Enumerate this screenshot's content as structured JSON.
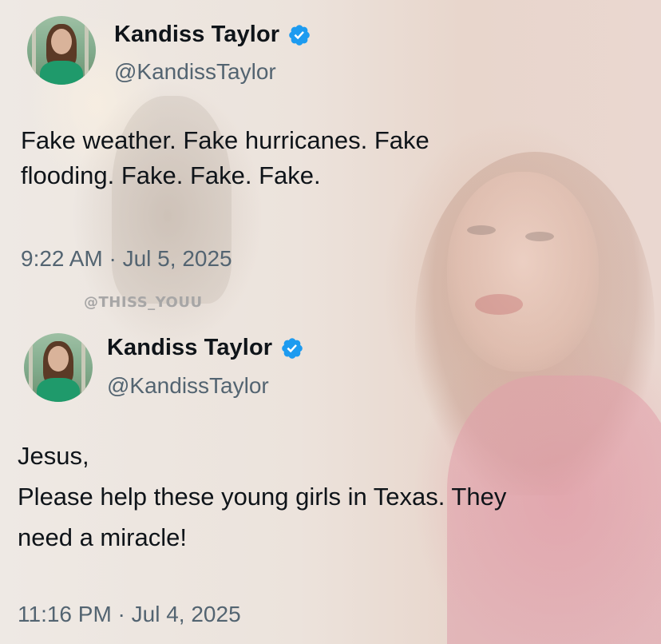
{
  "tweets": [
    {
      "display_name": "Kandiss Taylor",
      "handle": "@KandissTaylor",
      "verified_icon": "verified-badge-icon",
      "text_lines": [
        "Fake weather. Fake hurricanes. Fake",
        "flooding. Fake. Fake. Fake."
      ],
      "timestamp": "9:22 AM · Jul 5, 2025"
    },
    {
      "display_name": "Kandiss Taylor",
      "handle": "@KandissTaylor",
      "verified_icon": "verified-badge-icon",
      "text_lines": [
        "Jesus,",
        "Please help these young girls in Texas. They",
        "need a miracle!"
      ],
      "timestamp": "11:16 PM · Jul 4, 2025"
    }
  ],
  "watermark": "@THISS_YOUU",
  "colors": {
    "text": "#0f1419",
    "secondary_text": "#536471",
    "verified_blue": "#1d9bf0"
  }
}
